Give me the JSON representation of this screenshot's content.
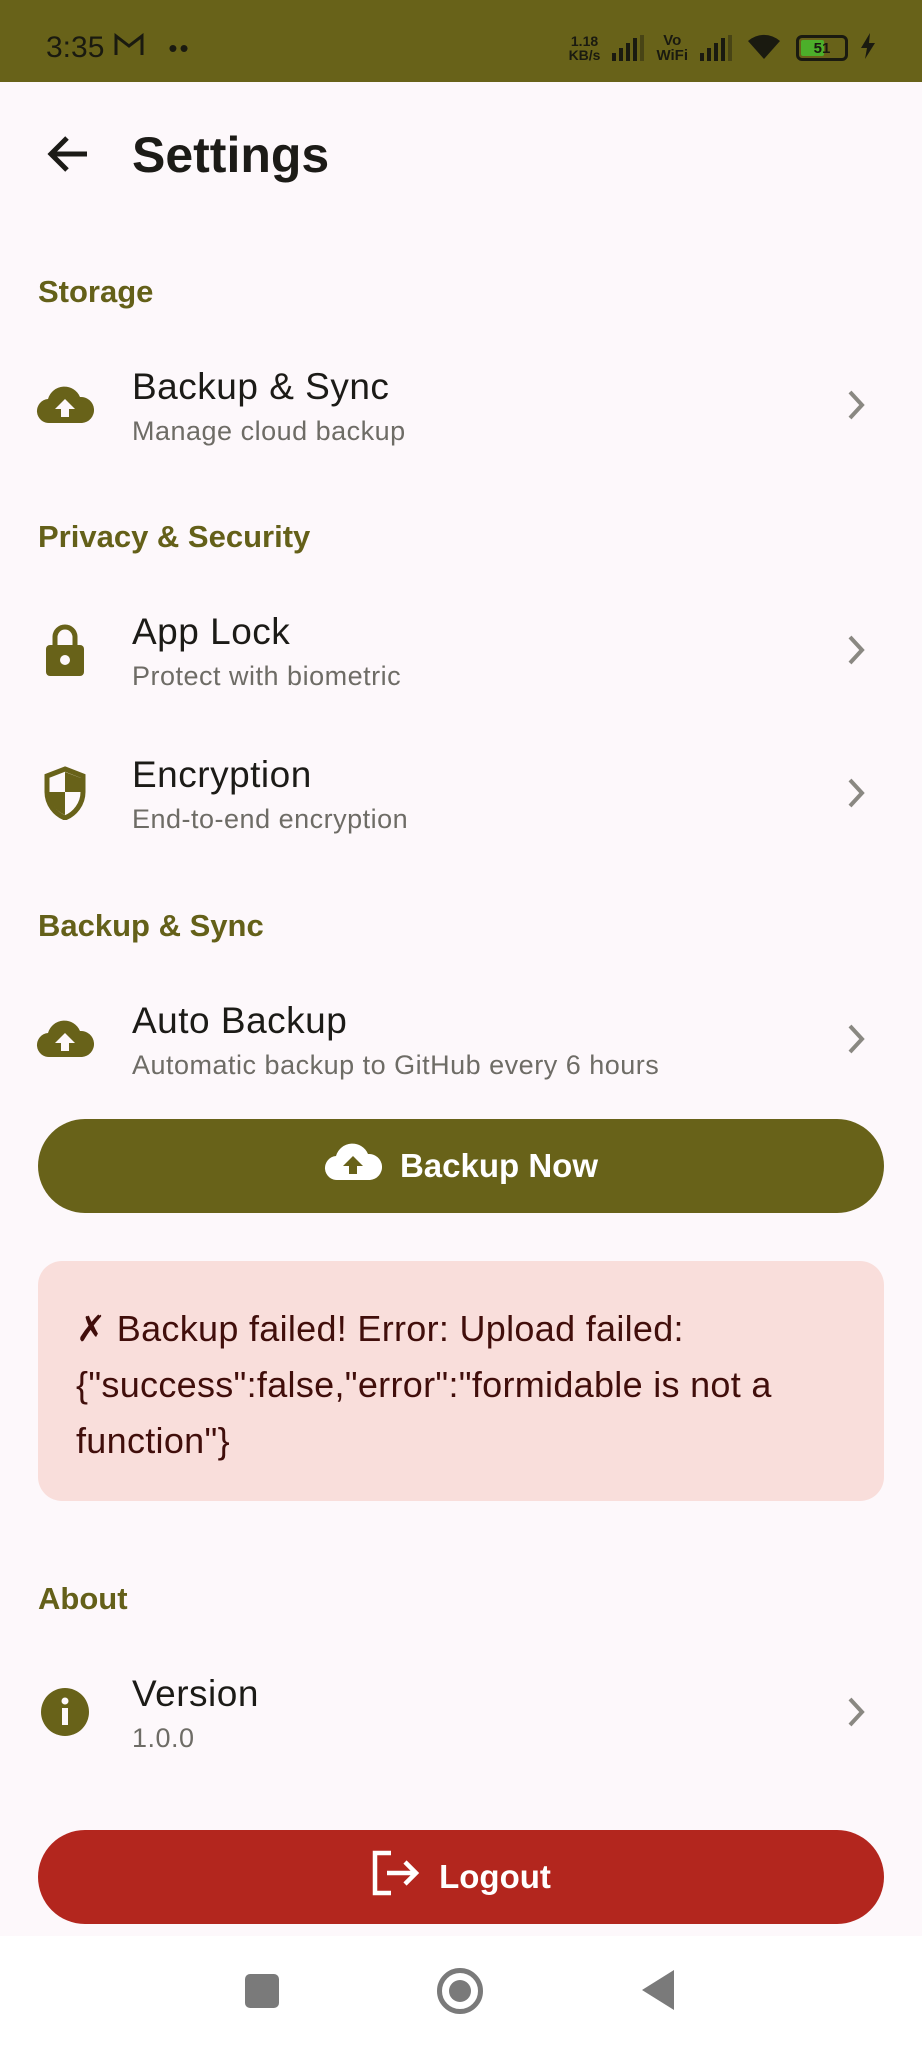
{
  "status_bar": {
    "time": "3:35",
    "net_speed_value": "1.18",
    "net_speed_unit": "KB/s",
    "vo": "Vo",
    "wifi_label": "WiFi",
    "battery": "51"
  },
  "header": {
    "title": "Settings"
  },
  "sections": {
    "storage": "Storage",
    "privacy": "Privacy & Security",
    "backup": "Backup & Sync",
    "about": "About"
  },
  "items": {
    "backup_sync": {
      "title": "Backup & Sync",
      "subtitle": "Manage cloud backup",
      "icon": "cloud-upload-icon"
    },
    "app_lock": {
      "title": "App Lock",
      "subtitle": "Protect with biometric",
      "icon": "lock-icon"
    },
    "encryption": {
      "title": "Encryption",
      "subtitle": "End-to-end encryption",
      "icon": "shield-icon"
    },
    "auto_backup": {
      "title": "Auto Backup",
      "subtitle": "Automatic backup to GitHub every 6 hours",
      "icon": "cloud-upload-icon"
    },
    "version": {
      "title": "Version",
      "subtitle": "1.0.0",
      "icon": "info-icon"
    }
  },
  "buttons": {
    "backup_now": "Backup Now",
    "logout": "Logout"
  },
  "error": {
    "message": "✗ Backup failed! Error: Upload failed: {\"success\":false,\"error\":\"formidable is not a function\"}"
  },
  "colors": {
    "primary": "#686219",
    "danger": "#b3261e",
    "error_container": "#f9dedb"
  }
}
